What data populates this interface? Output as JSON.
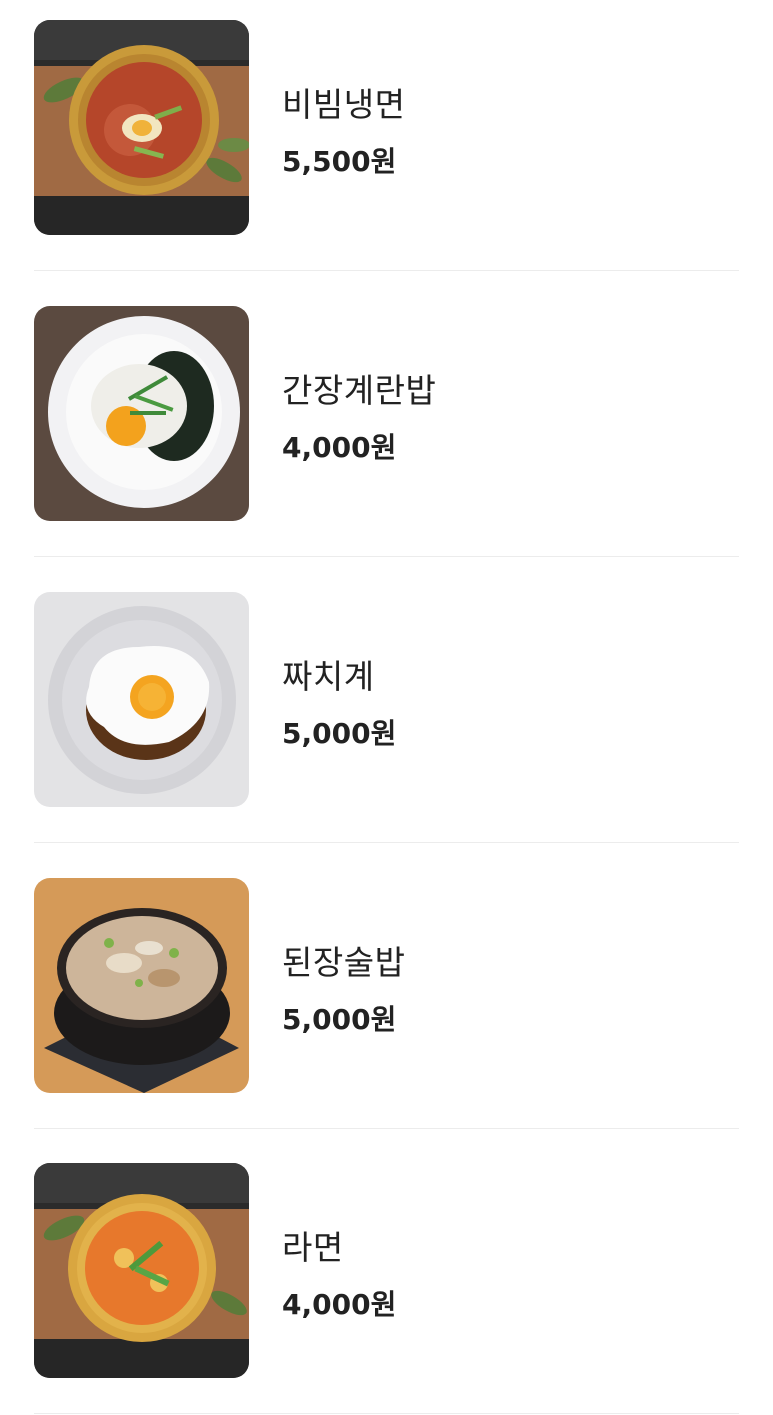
{
  "menu": {
    "items": [
      {
        "name": "비빔냉면",
        "price": "5,500원",
        "image_icon": "bibim-naengmyeon-dish-icon"
      },
      {
        "name": "간장계란밥",
        "price": "4,000원",
        "image_icon": "soy-egg-rice-dish-icon"
      },
      {
        "name": "짜치계",
        "price": "5,000원",
        "image_icon": "jjachigye-dish-icon"
      },
      {
        "name": "된장술밥",
        "price": "5,000원",
        "image_icon": "doenjang-sulbap-dish-icon"
      },
      {
        "name": "라면",
        "price": "4,000원",
        "image_icon": "ramyeon-dish-icon"
      }
    ]
  }
}
